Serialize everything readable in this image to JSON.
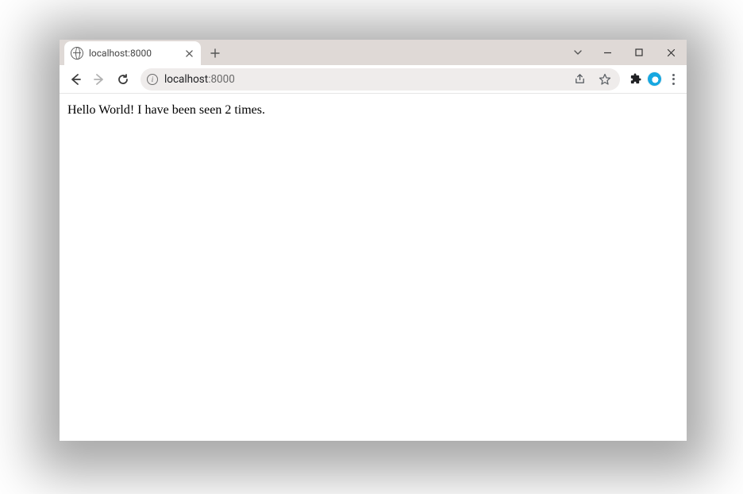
{
  "window": {
    "tab_title": "localhost:8000"
  },
  "toolbar": {
    "url_host": "localhost",
    "url_port": ":8000"
  },
  "page": {
    "body_text": "Hello World! I have been seen 2 times."
  }
}
